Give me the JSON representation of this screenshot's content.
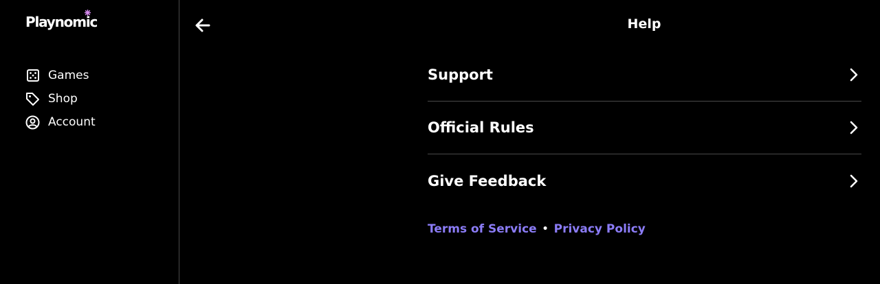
{
  "brand": {
    "name": "Playnomic",
    "accent_colors": [
      "#f2d33b",
      "#7be07b",
      "#d98cf2"
    ]
  },
  "sidebar": {
    "items": [
      {
        "label": "Games",
        "icon": "dice-icon"
      },
      {
        "label": "Shop",
        "icon": "tag-icon"
      },
      {
        "label": "Account",
        "icon": "user-circle-icon"
      }
    ]
  },
  "header": {
    "title": "Help",
    "back_icon": "arrow-left-icon"
  },
  "help": {
    "items": [
      {
        "label": "Support"
      },
      {
        "label": "Official Rules"
      },
      {
        "label": "Give Feedback"
      }
    ]
  },
  "footer": {
    "terms_label": "Terms of Service",
    "separator": "•",
    "privacy_label": "Privacy Policy",
    "link_color": "#8b7cf7"
  }
}
